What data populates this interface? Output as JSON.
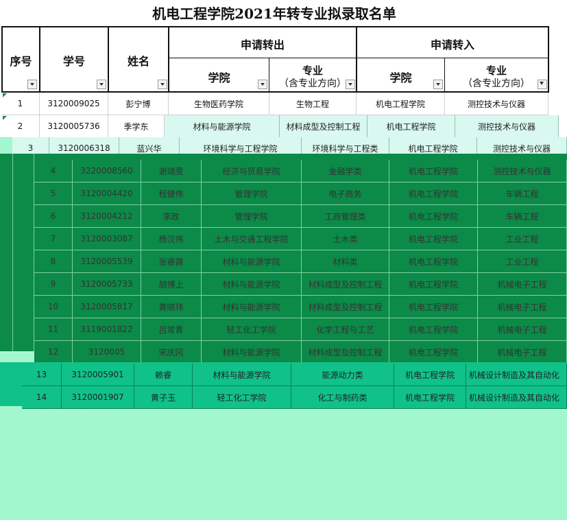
{
  "title": "机电工程学院2021年转专业拟录取名单",
  "headers": {
    "seq": "序号",
    "student_id": "学号",
    "name": "姓名",
    "transfer_out": "申请转出",
    "transfer_in": "申请转入",
    "college": "学院",
    "major_line1": "专业",
    "major_line2": "（含专业方向）"
  },
  "rows": [
    {
      "seq": "1",
      "id": "3120009025",
      "name": "彭宁博",
      "out_college": "生物医药学院",
      "out_major": "生物工程",
      "in_college": "机电工程学院",
      "in_major": "测控技术与仪器"
    },
    {
      "seq": "2",
      "id": "3120005736",
      "name": "季学东",
      "out_college": "材料与能源学院",
      "out_major": "材料成型及控制工程",
      "in_college": "机电工程学院",
      "in_major": "测控技术与仪器"
    },
    {
      "seq": "3",
      "id": "3120006318",
      "name": "蓝兴华",
      "out_college": "环境科学与工程学院",
      "out_major": "环境科学与工程类",
      "in_college": "机电工程学院",
      "in_major": "测控技术与仪器"
    },
    {
      "seq": "4",
      "id": "3220008560",
      "name": "谢靖雯",
      "out_college": "经济与贸易学院",
      "out_major": "金融学类",
      "in_college": "机电工程学院",
      "in_major": "测控技术与仪器"
    },
    {
      "seq": "5",
      "id": "3120004420",
      "name": "程健伟",
      "out_college": "管理学院",
      "out_major": "电子商务",
      "in_college": "机电工程学院",
      "in_major": "车辆工程"
    },
    {
      "seq": "6",
      "id": "3120004212",
      "name": "李政",
      "out_college": "管理学院",
      "out_major": "工商管理类",
      "in_college": "机电工程学院",
      "in_major": "车辆工程"
    },
    {
      "seq": "7",
      "id": "3120003087",
      "name": "杨汉伟",
      "out_college": "土木与交通工程学院",
      "out_major": "土木类",
      "in_college": "机电工程学院",
      "in_major": "工业工程"
    },
    {
      "seq": "8",
      "id": "3120005539",
      "name": "张睿霖",
      "out_college": "材料与能源学院",
      "out_major": "材料类",
      "in_college": "机电工程学院",
      "in_major": "工业工程"
    },
    {
      "seq": "9",
      "id": "3120005733",
      "name": "胡博上",
      "out_college": "材料与能源学院",
      "out_major": "材料成型及控制工程",
      "in_college": "机电工程学院",
      "in_major": "机械电子工程"
    },
    {
      "seq": "10",
      "id": "3120005817",
      "name": "黄晓玮",
      "out_college": "材料与能源学院",
      "out_major": "材料成型及控制工程",
      "in_college": "机电工程学院",
      "in_major": "机械电子工程"
    },
    {
      "seq": "11",
      "id": "3119001822",
      "name": "吕常青",
      "out_college": "轻工化工学院",
      "out_major": "化学工程与工艺",
      "in_college": "机电工程学院",
      "in_major": "机械电子工程"
    },
    {
      "seq": "12",
      "id": "3120005",
      "name": "宋庆冈",
      "out_college": "材料与能源学院",
      "out_major": "材料成型及控制工程",
      "in_college": "机电工程学院",
      "in_major": "机械电子工程"
    },
    {
      "seq": "13",
      "id": "3120005901",
      "name": "赖睿",
      "out_college": "材料与能源学院",
      "out_major": "能源动力类",
      "in_college": "机电工程学院",
      "in_major": "机械设计制造及其自动化"
    },
    {
      "seq": "14",
      "id": "3120001907",
      "name": "黄子玉",
      "out_college": "轻工化工学院",
      "out_major": "化工与制药类",
      "in_college": "机电工程学院",
      "in_major": "机械设计制造及其自动化"
    }
  ],
  "colors": {
    "white_bg": "#ffffff",
    "light_row": "#d9f8f0",
    "dark_band": "#0c8a48",
    "mint_band": "#10c28a",
    "page_bg": "#a3f7cf"
  }
}
